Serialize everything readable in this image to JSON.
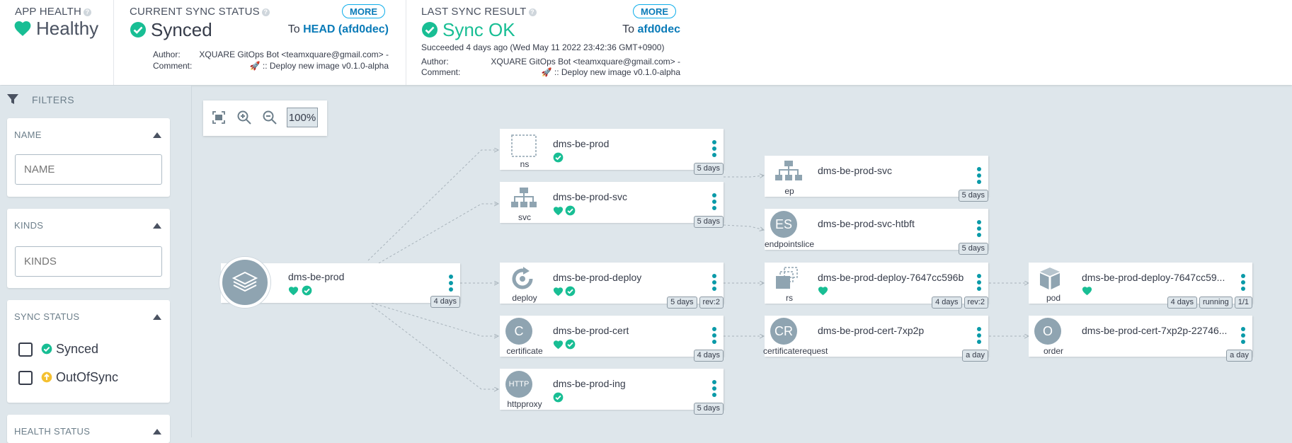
{
  "header": {
    "app_health": {
      "title": "APP HEALTH",
      "status": "Healthy"
    },
    "sync_status": {
      "title": "CURRENT SYNC STATUS",
      "status": "Synced",
      "more_label": "MORE",
      "to_prefix": "To",
      "revision": "HEAD (afd0dec)",
      "author_label": "Author:",
      "author": "XQUARE GitOps Bot <teamxquare@gmail.com> -",
      "comment_label": "Comment:",
      "comment": "🚀 :: Deploy new image v0.1.0-alpha"
    },
    "last_sync": {
      "title": "LAST SYNC RESULT",
      "status": "Sync OK",
      "more_label": "MORE",
      "to_prefix": "To",
      "revision": "afd0dec",
      "succeeded": "Succeeded 4 days ago (Wed May 11 2022 23:42:36 GMT+0900)",
      "author_label": "Author:",
      "author": "XQUARE GitOps Bot <teamxquare@gmail.com> -",
      "comment_label": "Comment:",
      "comment": "🚀 :: Deploy new image v0.1.0-alpha"
    }
  },
  "sidebar": {
    "filters_label": "FILTERS",
    "name": {
      "title": "NAME",
      "placeholder": "NAME"
    },
    "kinds": {
      "title": "KINDS",
      "placeholder": "KINDS"
    },
    "sync_status": {
      "title": "SYNC STATUS",
      "options": [
        "Synced",
        "OutOfSync"
      ]
    },
    "health_status": {
      "title": "HEALTH STATUS"
    }
  },
  "toolbar": {
    "zoom": "100%"
  },
  "root": {
    "name": "dms-be-prod",
    "tags": [
      "4 days"
    ]
  },
  "nodes": [
    {
      "name": "dms-be-prod",
      "kind": "ns",
      "tags": [
        "5 days"
      ]
    },
    {
      "name": "dms-be-prod-svc",
      "kind": "svc",
      "tags": [
        "5 days"
      ]
    },
    {
      "name": "dms-be-prod-deploy",
      "kind": "deploy",
      "tags": [
        "5 days",
        "rev:2"
      ]
    },
    {
      "name": "dms-be-prod-cert",
      "kind": "certificate",
      "icon_text": "C",
      "tags": [
        "4 days"
      ]
    },
    {
      "name": "dms-be-prod-ing",
      "kind": "httpproxy",
      "icon_text": "HTTP",
      "tags": [
        "5 days"
      ]
    },
    {
      "name": "dms-be-prod-svc",
      "kind": "ep",
      "tags": [
        "5 days"
      ]
    },
    {
      "name": "dms-be-prod-svc-htbft",
      "kind": "endpointslice",
      "icon_text": "ES",
      "tags": [
        "5 days"
      ]
    },
    {
      "name": "dms-be-prod-deploy-7647cc596b",
      "kind": "rs",
      "tags": [
        "4 days",
        "rev:2"
      ]
    },
    {
      "name": "dms-be-prod-cert-7xp2p",
      "kind": "certificaterequest",
      "icon_text": "CR",
      "tags": [
        "a day"
      ]
    },
    {
      "name": "dms-be-prod-deploy-7647cc59...",
      "kind": "pod",
      "tags": [
        "4 days",
        "running",
        "1/1"
      ]
    },
    {
      "name": "dms-be-prod-cert-7xp2p-22746...",
      "kind": "order",
      "icon_text": "O",
      "tags": [
        "a day"
      ]
    }
  ],
  "colors": {
    "healthy": "#18be94",
    "out_of_sync": "#f4c030",
    "link": "#0a7bb8",
    "teal_dots": "#0a9aa8"
  }
}
